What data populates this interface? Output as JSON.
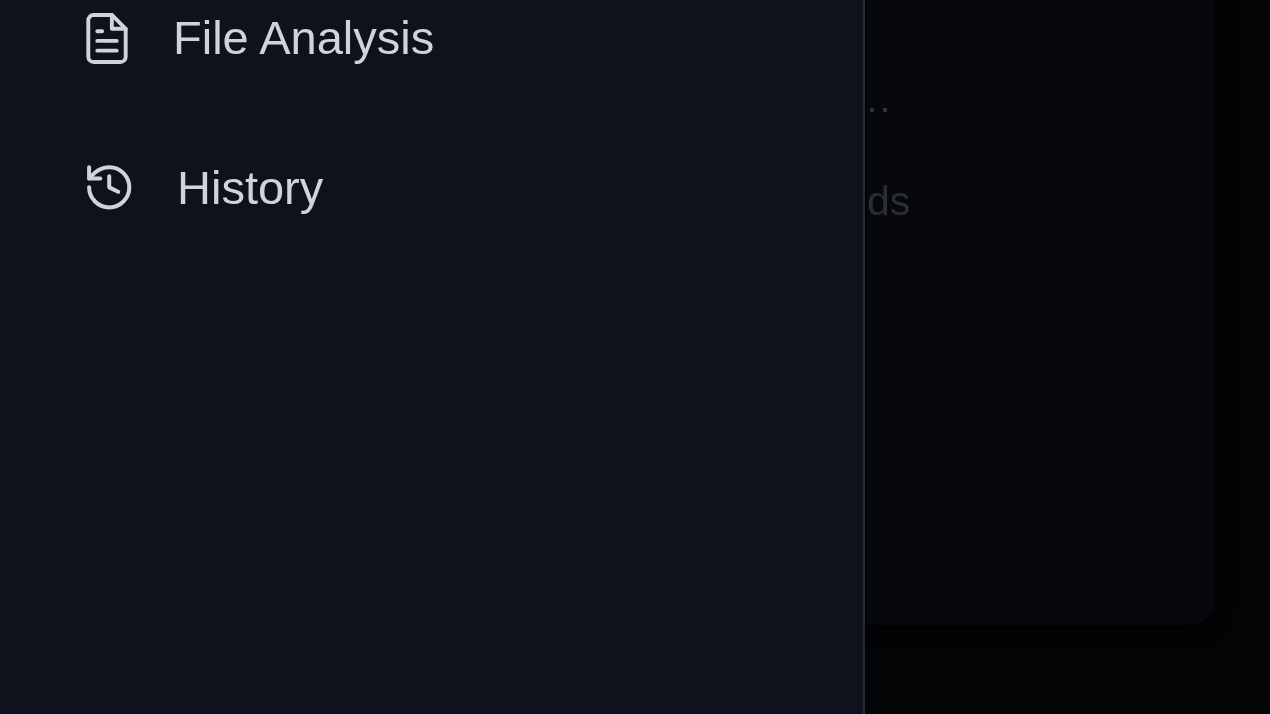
{
  "drawer": {
    "items": [
      {
        "label": "File Analysis",
        "selected": false
      },
      {
        "label": "History",
        "selected": false
      }
    ]
  },
  "background_card": {
    "texts": [
      "..",
      "ds"
    ]
  }
}
